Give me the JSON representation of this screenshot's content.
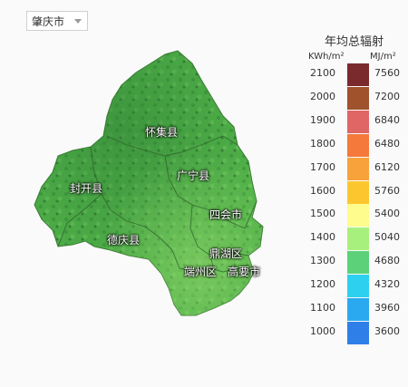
{
  "city_selector": {
    "label": "肇庆市"
  },
  "places": [
    {
      "name": "怀集县"
    },
    {
      "name": "广宁县"
    },
    {
      "name": "封开县"
    },
    {
      "name": "四会市"
    },
    {
      "name": "德庆县"
    },
    {
      "name": "鼎湖区"
    },
    {
      "name": "端州区"
    },
    {
      "name": "高要市"
    }
  ],
  "legend": {
    "title": "年均总辐射",
    "unit_left": "KWh/m²",
    "unit_right": "MJ/m²",
    "rows": [
      {
        "kwh": "2100",
        "mj": "7560",
        "color": "#7a2a2c"
      },
      {
        "kwh": "2000",
        "mj": "7200",
        "color": "#a0522d"
      },
      {
        "kwh": "1900",
        "mj": "6840",
        "color": "#e06666"
      },
      {
        "kwh": "1800",
        "mj": "6480",
        "color": "#f5793a"
      },
      {
        "kwh": "1700",
        "mj": "6120",
        "color": "#f7a23a"
      },
      {
        "kwh": "1600",
        "mj": "5760",
        "color": "#fcc72e"
      },
      {
        "kwh": "1500",
        "mj": "5400",
        "color": "#fefc8c"
      },
      {
        "kwh": "1400",
        "mj": "5040",
        "color": "#a8f07e"
      },
      {
        "kwh": "1300",
        "mj": "4680",
        "color": "#5cd17a"
      },
      {
        "kwh": "1200",
        "mj": "4320",
        "color": "#2ed0f0"
      },
      {
        "kwh": "1100",
        "mj": "3960",
        "color": "#2aa9f0"
      },
      {
        "kwh": "1000",
        "mj": "3600",
        "color": "#2f7fe8"
      }
    ]
  }
}
